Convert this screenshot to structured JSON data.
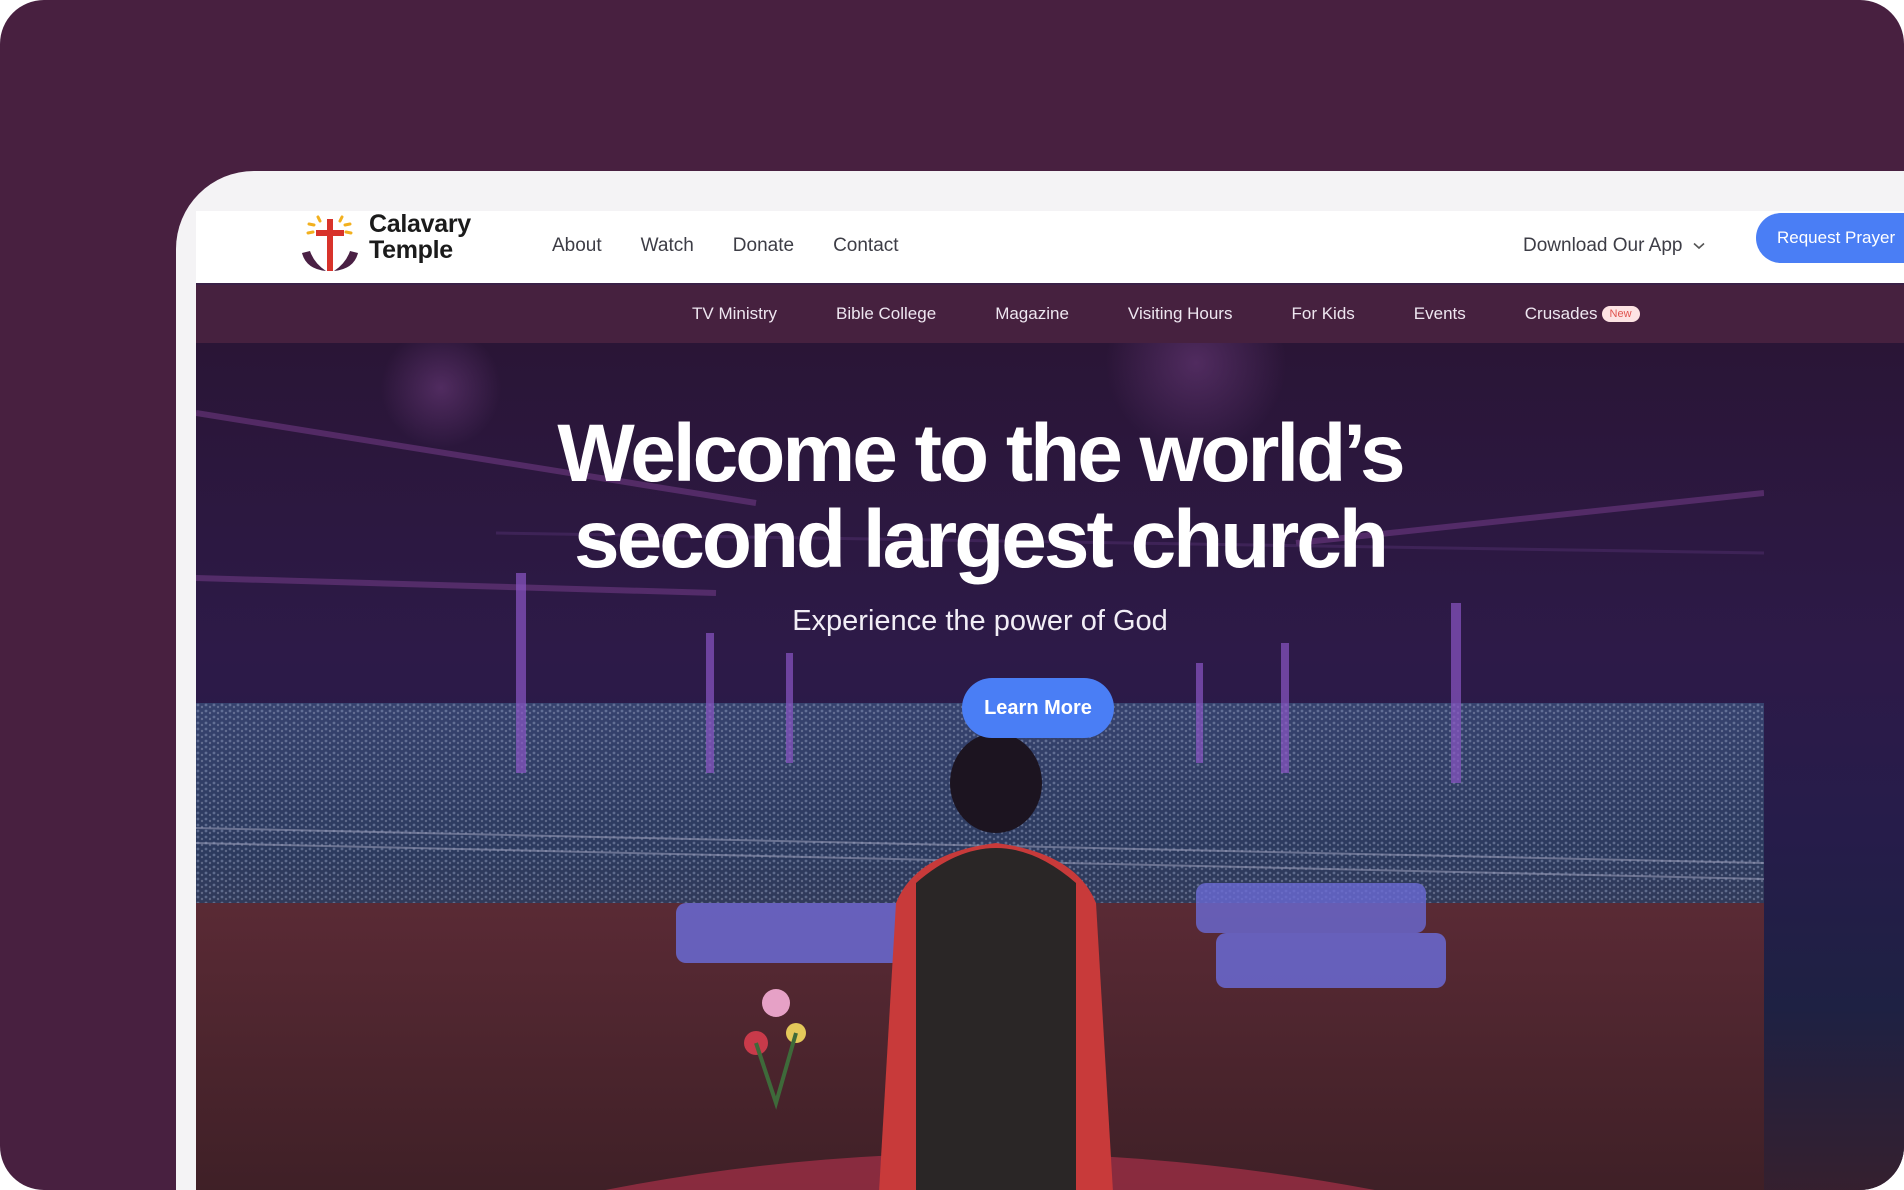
{
  "brand": {
    "name_line1": "Calavary",
    "name_line2": "Temple"
  },
  "nav": {
    "links": [
      "About",
      "Watch",
      "Donate",
      "Contact"
    ],
    "download": "Download Our App",
    "request": "Request Prayer"
  },
  "subnav": {
    "items": [
      "TV Ministry",
      "Bible College",
      "Magazine",
      "Visiting Hours",
      "For Kids",
      "Events",
      "Crusades"
    ],
    "badge": "New"
  },
  "hero": {
    "title_line1": "Welcome to the world’s",
    "title_line2": "second largest church",
    "subtitle": "Experience the power of God",
    "cta": "Learn More"
  },
  "colors": {
    "accent": "#4a7ef5",
    "brand_purple": "#46213f",
    "frame": "#482040"
  }
}
